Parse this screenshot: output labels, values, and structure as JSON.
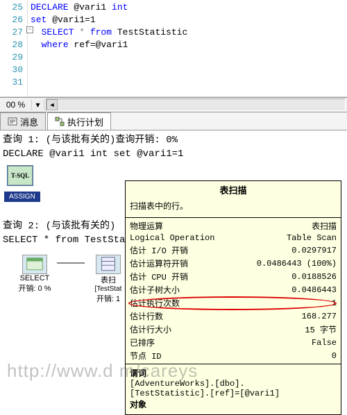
{
  "editor": {
    "line_numbers": [
      "25",
      "26",
      "27",
      "28",
      "29",
      "30",
      "31"
    ],
    "l25_kw1": "DECLARE",
    "l25_rest": " @vari1 ",
    "l25_kw2": "int",
    "l26_kw": "set",
    "l26_rest": " @vari1=1",
    "l27_kw1": "SELECT",
    "l27_star": " * ",
    "l27_kw2": "from",
    "l27_rest": " TestStatistic",
    "l28_kw": "where",
    "l28_rest": " ref=@vari1",
    "fold_glyph": "−"
  },
  "zoom": {
    "value": "00 %",
    "dropdown_glyph": "▾",
    "left_glyph": "◄"
  },
  "tabs": {
    "messages": "消息",
    "plan": "执行计划"
  },
  "query1": {
    "heading": "查询 1: (与该批有关的)查询开销: 0%",
    "stmt": "DECLARE @vari1 int set @vari1=1"
  },
  "plan1": {
    "tsql": "T-SQL",
    "assign": "ASSIGN"
  },
  "query2": {
    "heading_prefix": "查询 2: (与该批有关的)",
    "stmt_prefix": "SELECT * from TestSta"
  },
  "plan2": {
    "select_label": "SELECT",
    "select_cost": "开销: 0 %",
    "scan_label": "表扫",
    "scan_sub": "[TestStat",
    "scan_cost": "开销: 1"
  },
  "tooltip": {
    "title": "表扫描",
    "desc": "扫描表中的行。",
    "rows": [
      {
        "k": "物理运算",
        "v": "表扫描"
      },
      {
        "k": "Logical Operation",
        "v": "Table Scan"
      },
      {
        "k": "估计 I/O 开销",
        "v": "0.0297917"
      },
      {
        "k": "估计运算符开销",
        "v": "0.0486443 (100%)"
      },
      {
        "k": "估计 CPU 开销",
        "v": "0.0188526"
      },
      {
        "k": "估计子树大小",
        "v": "0.0486443"
      },
      {
        "k": "估计执行次数",
        "v": "1"
      },
      {
        "k": "估计行数",
        "v": "168.277",
        "hl": true
      },
      {
        "k": "估计行大小",
        "v": "15 字节"
      },
      {
        "k": "已排序",
        "v": "False"
      },
      {
        "k": "节点 ID",
        "v": "0"
      }
    ],
    "predicate_label": "谓词",
    "predicate_l1": "[AdventureWorks].[dbo].",
    "predicate_l2": "[TestStatistic].[ref]=[@vari1]",
    "object_label": "对象"
  },
  "watermark": "http://www.d               m/careys"
}
